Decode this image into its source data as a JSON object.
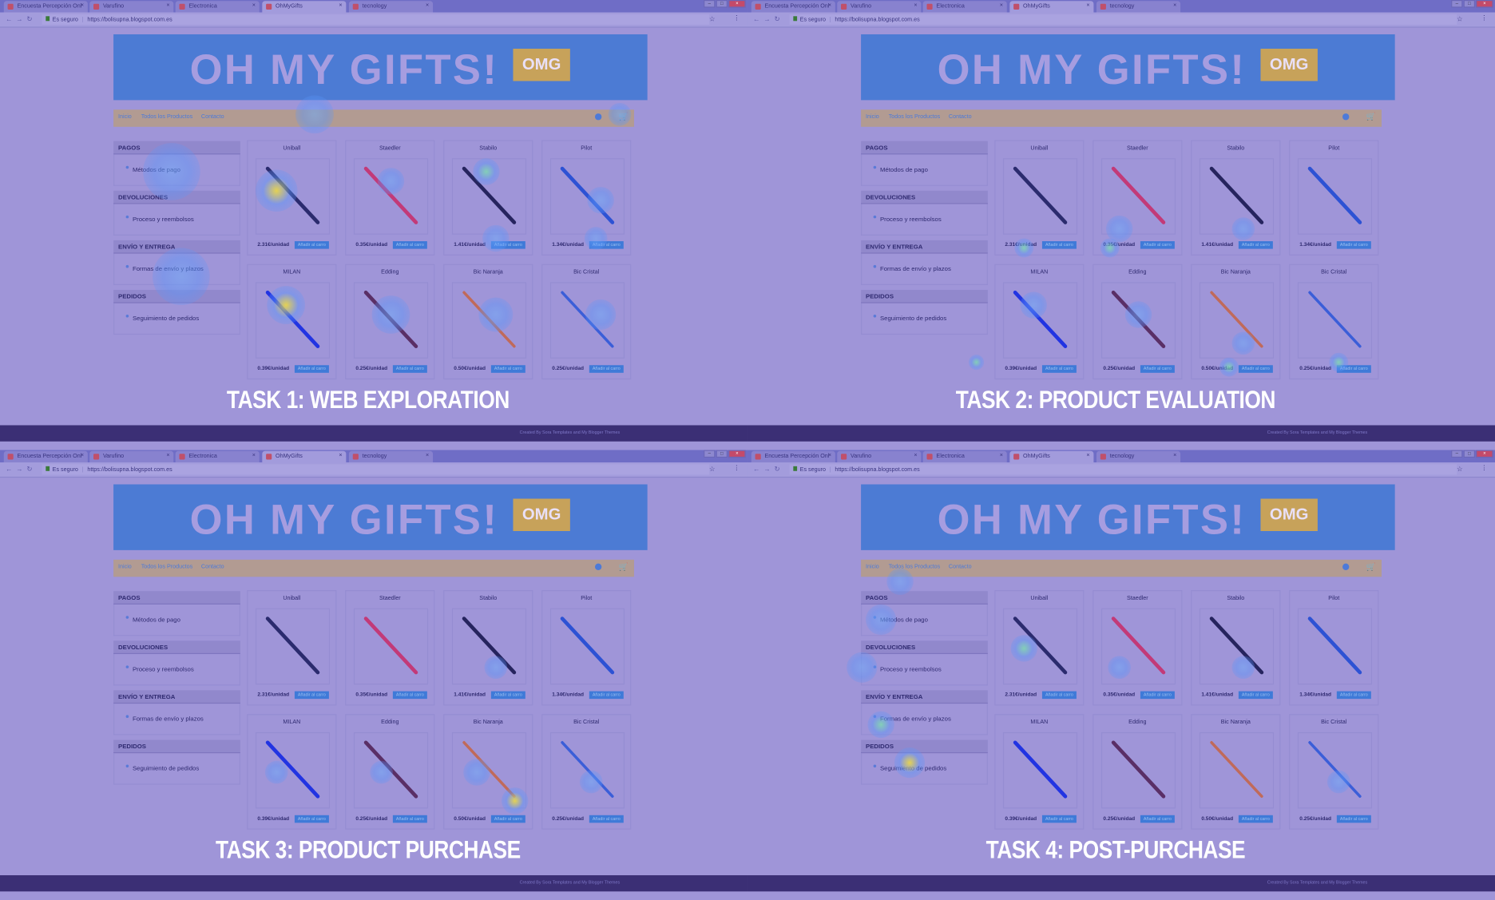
{
  "browser": {
    "tabs": [
      {
        "label": "Encuesta Percepción Onl",
        "active": false
      },
      {
        "label": "Varufino",
        "active": false
      },
      {
        "label": "Electronica",
        "active": false
      },
      {
        "label": "OhMyGifts",
        "active": true
      },
      {
        "label": "tecnology",
        "active": false
      }
    ],
    "secure_label": "Es seguro",
    "url": "https://bolisupna.blogspot.com.es"
  },
  "site": {
    "logo_text": "OH MY GIFTS!",
    "badge": "OMG",
    "nav": [
      "Inicio",
      "Todos los Productos",
      "Contacto"
    ],
    "sidebar": [
      {
        "header": "PAGOS",
        "item": "Métodos de pago"
      },
      {
        "header": "DEVOLUCIONES",
        "item": "Proceso y reembolsos"
      },
      {
        "header": "ENVÍO Y ENTREGA",
        "item": "Formas de envío y plazos"
      },
      {
        "header": "PEDIDOS",
        "item": "Seguimiento de pedidos"
      }
    ],
    "products": [
      {
        "name": "Uniball",
        "price": "2.31€/unidad",
        "color": "#2b2b6e"
      },
      {
        "name": "Staedler",
        "price": "0.35€/unidad",
        "color": "#c23a78"
      },
      {
        "name": "Stabilo",
        "price": "1.41€/unidad",
        "color": "#26245e"
      },
      {
        "name": "Pilot",
        "price": "1.34€/unidad",
        "color": "#2d52d4"
      },
      {
        "name": "MILAN",
        "price": "0.39€/unidad",
        "color": "#2234e2"
      },
      {
        "name": "Edding",
        "price": "0.25€/unidad",
        "color": "#5a2f66"
      },
      {
        "name": "Bic Naranja",
        "price": "0.50€/unidad",
        "color": "#c06a5a"
      },
      {
        "name": "Bic Cristal",
        "price": "0.25€/unidad",
        "color": "#3b5ed8"
      }
    ],
    "add_to_cart": "Añadir al carro",
    "footer": "Created By Sora Templates and My Blogger Themes"
  },
  "quadrants": [
    {
      "title": "TASK 1: WEB EXPLORATION"
    },
    {
      "title": "TASK 2: PRODUCT EVALUATION"
    },
    {
      "title": "TASK 3: PRODUCT PURCHASE"
    },
    {
      "title": "TASK 4: POST-PURCHASE"
    }
  ]
}
